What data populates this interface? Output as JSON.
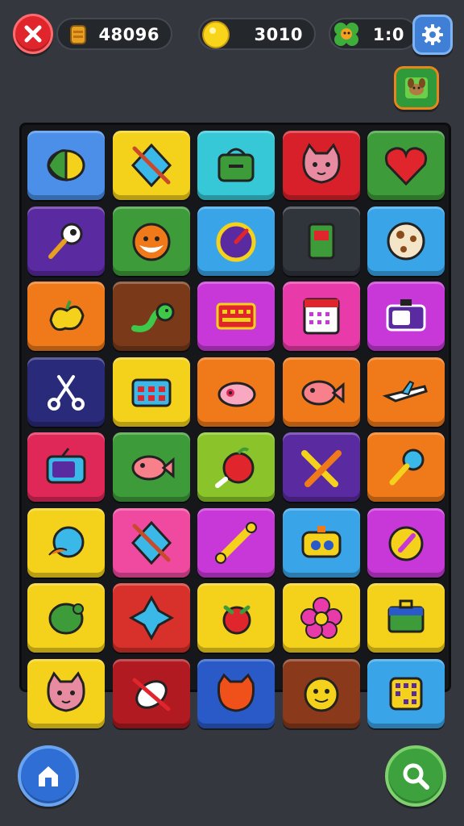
{
  "top_bar": {
    "gems_value": "48096",
    "coins_value": "3010",
    "moves_value": "1:0"
  },
  "board": {
    "tiles": [
      {
        "bg": "#4b8fe8",
        "icon": "lemon-icon"
      },
      {
        "bg": "#f4d21b",
        "icon": "kite-icon"
      },
      {
        "bg": "#36c8d6",
        "icon": "bag-icon"
      },
      {
        "bg": "#d8202a",
        "icon": "cat-face-icon"
      },
      {
        "bg": "#3e9b3a",
        "icon": "heart-icon"
      },
      {
        "bg": "#5a2aa0",
        "icon": "magnifier-icon"
      },
      {
        "bg": "#3e9b3a",
        "icon": "fox-face-icon"
      },
      {
        "bg": "#3aa4e8",
        "icon": "gauge-icon"
      },
      {
        "bg": "#30353c",
        "icon": "card-icon"
      },
      {
        "bg": "#3aa4e8",
        "icon": "cookie-icon"
      },
      {
        "bg": "#f07a1a",
        "icon": "pepper-icon"
      },
      {
        "bg": "#7a3a1a",
        "icon": "snake-icon"
      },
      {
        "bg": "#c838d8",
        "icon": "keyboard-icon"
      },
      {
        "bg": "#e83aa8",
        "icon": "calendar-icon"
      },
      {
        "bg": "#c838d8",
        "icon": "radio-icon"
      },
      {
        "bg": "#2a2a7a",
        "icon": "scissors-icon"
      },
      {
        "bg": "#f4d21b",
        "icon": "toolbox-icon"
      },
      {
        "bg": "#f07a1a",
        "icon": "pig-icon"
      },
      {
        "bg": "#f07a1a",
        "icon": "fish-icon"
      },
      {
        "bg": "#f07a1a",
        "icon": "plane-icon"
      },
      {
        "bg": "#e02858",
        "icon": "tv-icon"
      },
      {
        "bg": "#3e9b3a",
        "icon": "fish-icon"
      },
      {
        "bg": "#8ac42a",
        "icon": "apple-icon"
      },
      {
        "bg": "#5a2aa0",
        "icon": "pencils-icon"
      },
      {
        "bg": "#f07a1a",
        "icon": "racket-icon"
      },
      {
        "bg": "#f4d21b",
        "icon": "globe-icon"
      },
      {
        "bg": "#f04aa0",
        "icon": "kite-icon"
      },
      {
        "bg": "#c838d8",
        "icon": "bone-icon"
      },
      {
        "bg": "#3aa4e8",
        "icon": "camera-icon"
      },
      {
        "bg": "#c838d8",
        "icon": "compass-icon"
      },
      {
        "bg": "#f4d21b",
        "icon": "turtle-icon"
      },
      {
        "bg": "#d8302a",
        "icon": "star-shape-icon"
      },
      {
        "bg": "#f4d21b",
        "icon": "berry-icon"
      },
      {
        "bg": "#f4d21b",
        "icon": "flower-icon"
      },
      {
        "bg": "#f4d21b",
        "icon": "briefcase-icon"
      },
      {
        "bg": "#f4d21b",
        "icon": "cat-face-icon"
      },
      {
        "bg": "#b01a20",
        "icon": "rocket-icon"
      },
      {
        "bg": "#2a5ac8",
        "icon": "orange-cat-icon"
      },
      {
        "bg": "#8a3a1a",
        "icon": "smiley-cat-icon"
      },
      {
        "bg": "#3aa4e8",
        "icon": "dice-icon"
      }
    ]
  }
}
